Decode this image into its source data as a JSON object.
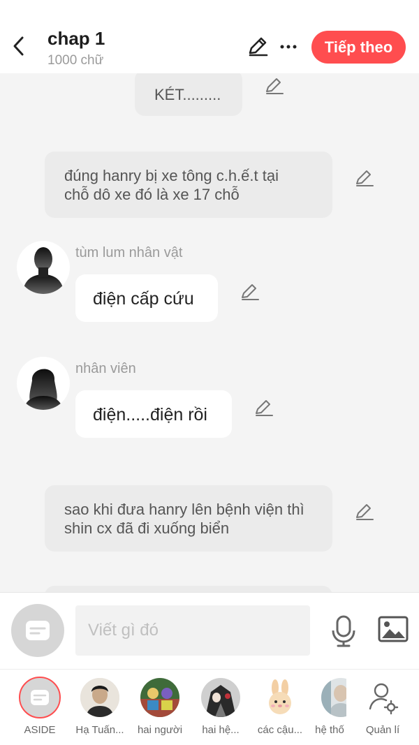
{
  "header": {
    "title": "chap 1",
    "word_count": "1000 chữ",
    "next_label": "Tiếp theo",
    "accent": "#ff4d4f"
  },
  "messages": [
    {
      "type": "narration",
      "text": "KÉT........."
    },
    {
      "type": "narration",
      "text_line1": "đúng hanry bị xe tông c.h.ế.t tại",
      "text_line2": "chỗ dô xe đó là xe 17 chỗ"
    },
    {
      "type": "character",
      "name": "tùm lum nhân vật",
      "text": "điện cấp cứu",
      "avatar": "male-silhouette-icon"
    },
    {
      "type": "character",
      "name": "nhân viên",
      "text": "điện.....điện rồi",
      "avatar": "female-silhouette-icon"
    },
    {
      "type": "narration",
      "text_line1": "sao khi đưa hanry lên bệnh viện thì",
      "text_line2": "shin cx đã đi xuống biển"
    }
  ],
  "composer": {
    "placeholder": "Viết gì đó",
    "mic_icon": "microphone-icon",
    "image_icon": "image-icon"
  },
  "characters": [
    {
      "label": "ASIDE",
      "icon": "aside-icon",
      "selected": true
    },
    {
      "label": "Hạ Tuấn...",
      "icon": "avatar-photo"
    },
    {
      "label": "hai người",
      "icon": "avatar-photo"
    },
    {
      "label": "hai hệ...",
      "icon": "avatar-photo"
    },
    {
      "label": "các cậu...",
      "icon": "avatar-photo"
    },
    {
      "label": "hệ thố",
      "icon": "avatar-photo"
    },
    {
      "label": "Quản lí",
      "icon": "manage-user-icon"
    }
  ]
}
